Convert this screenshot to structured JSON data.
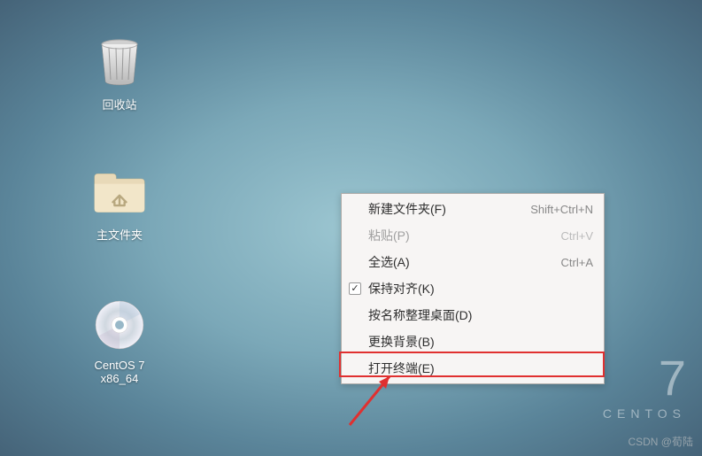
{
  "desktop": {
    "icons": {
      "trash": {
        "label": "回收站"
      },
      "home": {
        "label": "主文件夹"
      },
      "cdrom": {
        "label": "CentOS 7 x86_64"
      }
    }
  },
  "context_menu": {
    "items": [
      {
        "label": "新建文件夹(F)",
        "shortcut": "Shift+Ctrl+N",
        "enabled": true,
        "checkbox": false
      },
      {
        "label": "粘贴(P)",
        "shortcut": "Ctrl+V",
        "enabled": false,
        "checkbox": false
      },
      {
        "label": "全选(A)",
        "shortcut": "Ctrl+A",
        "enabled": true,
        "checkbox": false
      },
      {
        "label": "保持对齐(K)",
        "shortcut": "",
        "enabled": true,
        "checkbox": true,
        "checked": true
      },
      {
        "label": "按名称整理桌面(D)",
        "shortcut": "",
        "enabled": true,
        "checkbox": false
      },
      {
        "label": "更换背景(B)",
        "shortcut": "",
        "enabled": true,
        "checkbox": false
      },
      {
        "label": "打开终端(E)",
        "shortcut": "",
        "enabled": true,
        "checkbox": false,
        "highlighted": true
      }
    ]
  },
  "branding": {
    "version": "7",
    "name": "CENTOS"
  },
  "watermark": "CSDN @荀陆"
}
